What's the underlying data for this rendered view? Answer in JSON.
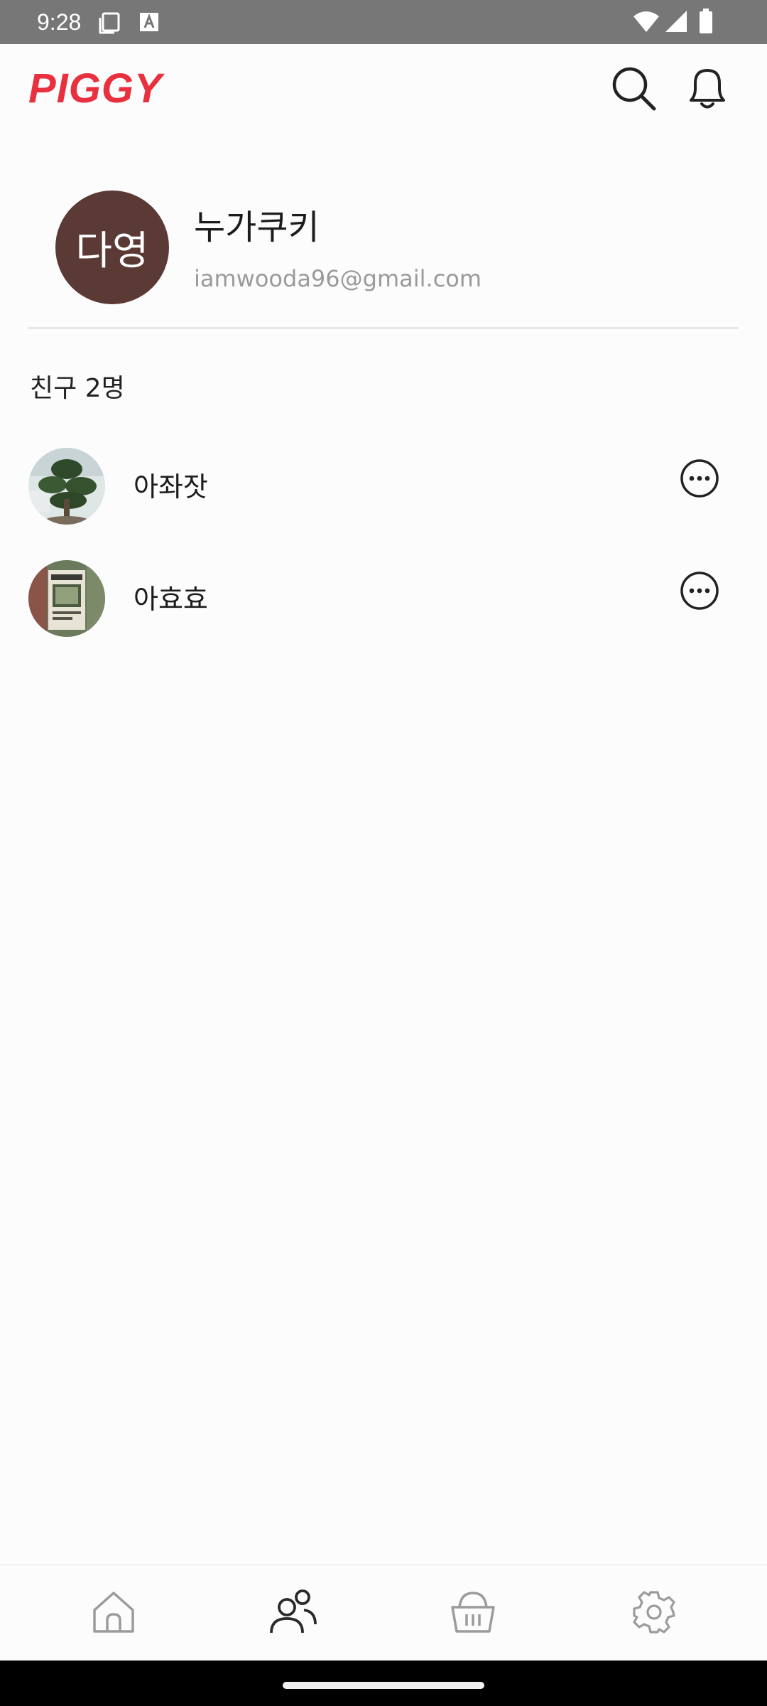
{
  "status_bar": {
    "time": "9:28",
    "icons": [
      "screenshot-icon",
      "keyboard-a-icon",
      "wifi-icon",
      "signal-icon",
      "battery-icon"
    ]
  },
  "header": {
    "logo": "PIGGY",
    "logo_color": "#e8303e",
    "search_icon": "search-icon",
    "notification_icon": "bell-icon"
  },
  "profile": {
    "initials": "다영",
    "avatar_color": "#5b3a36",
    "name": "누가쿠키",
    "email": "iamwooda96@gmail.com"
  },
  "friends": {
    "title": "친구 2명",
    "items": [
      {
        "name": "아좌잣",
        "avatar": "bonsai-tree-photo",
        "more_icon": "more-options-icon"
      },
      {
        "name": "아효효",
        "avatar": "poster-photo",
        "more_icon": "more-options-icon"
      }
    ]
  },
  "bottom_nav": {
    "items": [
      {
        "icon": "home-icon",
        "active": false
      },
      {
        "icon": "friends-icon",
        "active": true
      },
      {
        "icon": "basket-icon",
        "active": false
      },
      {
        "icon": "settings-icon",
        "active": false
      }
    ],
    "active_color": "#2a2a2a",
    "inactive_color": "#9b9b9b"
  }
}
